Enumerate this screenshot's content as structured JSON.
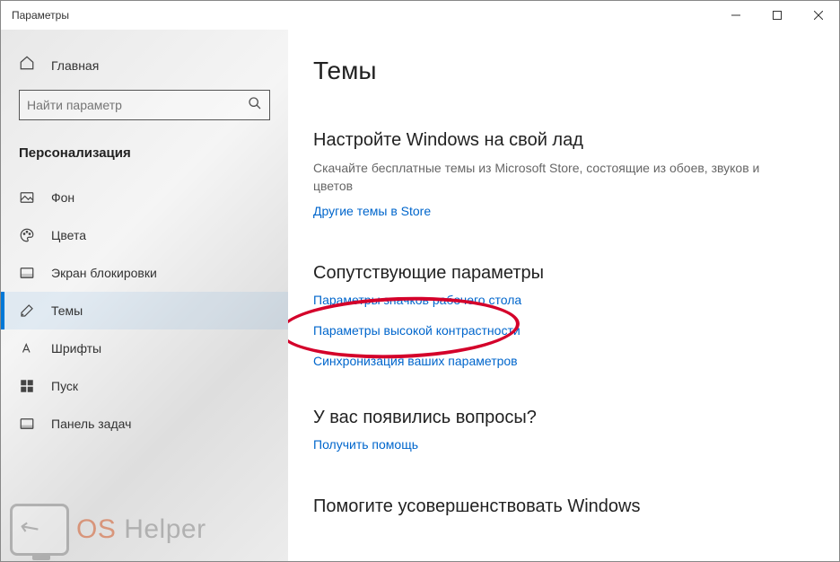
{
  "window": {
    "title": "Параметры"
  },
  "sidebar": {
    "home": "Главная",
    "search_placeholder": "Найти параметр",
    "category": "Персонализация",
    "items": [
      {
        "label": "Фон"
      },
      {
        "label": "Цвета"
      },
      {
        "label": "Экран блокировки"
      },
      {
        "label": "Темы"
      },
      {
        "label": "Шрифты"
      },
      {
        "label": "Пуск"
      },
      {
        "label": "Панель задач"
      }
    ]
  },
  "main": {
    "title": "Темы",
    "section1": {
      "title": "Настройте Windows на свой лад",
      "desc": "Скачайте бесплатные темы из Microsoft Store, состоящие из обоев, звуков и цветов",
      "link": "Другие темы в Store"
    },
    "section2": {
      "title": "Сопутствующие параметры",
      "link1": "Параметры значков рабочего стола",
      "link2": "Параметры высокой контрастности",
      "link3": "Синхронизация ваших параметров"
    },
    "section3": {
      "title": "У вас появились вопросы?",
      "link": "Получить помощь"
    },
    "section4": {
      "title": "Помогите усовершенствовать Windows"
    }
  },
  "watermark": {
    "os": "OS",
    "helper": " Helper"
  }
}
